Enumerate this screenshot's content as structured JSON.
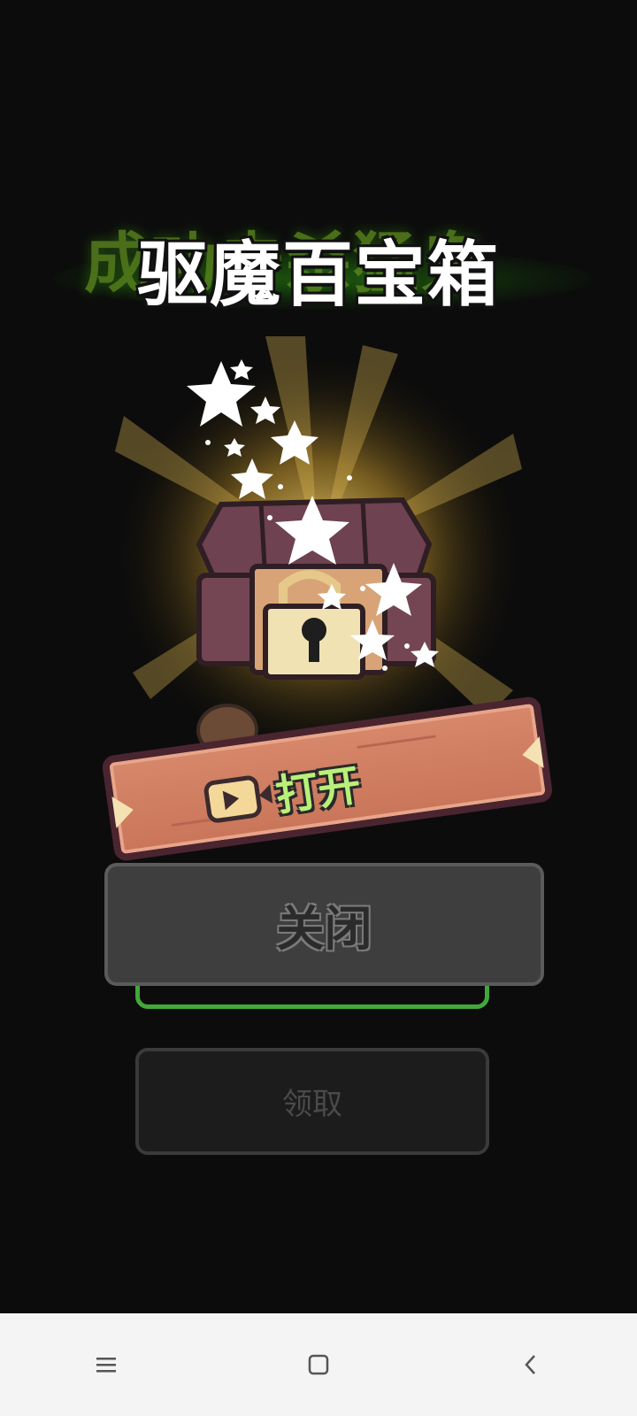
{
  "background": {
    "faded_title": "成功击杀猛鬼"
  },
  "dialog": {
    "title": "驱魔百宝箱",
    "open_button_label": "打开",
    "close_button_label": "关闭",
    "claim_button_label": "领取"
  },
  "icons": {
    "chest": "treasure-chest-icon",
    "video": "video-ad-icon",
    "stars": "sparkle-stars",
    "nav_menu": "menu-icon",
    "nav_home": "home-square-icon",
    "nav_back": "back-chevron-icon"
  },
  "colors": {
    "title_text": "#ffffff",
    "open_label": "#b9f07a",
    "banner_wood": "#cf7c60",
    "close_bg": "#3e3e3e",
    "claim_bg": "#1c1c1c",
    "green_outline": "#42a83a"
  }
}
